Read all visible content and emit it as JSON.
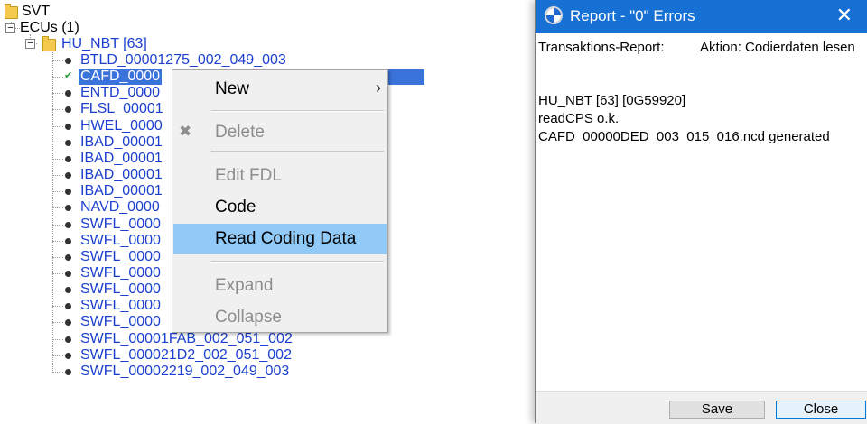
{
  "tree": {
    "svt_label": "SVT",
    "ecus_label": "ECUs (1)",
    "hu_label": "HU_NBT [63]",
    "items": [
      "BTLD_00001275_002_049_003",
      "CAFD_0000",
      "ENTD_0000",
      "FLSL_00001",
      "HWEL_0000",
      "IBAD_00001",
      "IBAD_00001",
      "IBAD_00001",
      "IBAD_00001",
      "NAVD_0000",
      "SWFL_0000",
      "SWFL_0000",
      "SWFL_0000",
      "SWFL_0000",
      "SWFL_0000",
      "SWFL_0000",
      "SWFL_0000",
      "SWFL_00001FAB_002_051_002",
      "SWFL_000021D2_002_051_002",
      "SWFL_00002219_002_049_003"
    ]
  },
  "context_menu": {
    "new": "New",
    "delete": "Delete",
    "edit_fdl": "Edit FDL",
    "code": "Code",
    "read_coding_data": "Read Coding Data",
    "expand": "Expand",
    "collapse": "Collapse"
  },
  "report": {
    "title": "Report - \"0\" Errors",
    "header_left": "Transaktions-Report:",
    "header_right": "Aktion: Codierdaten lesen",
    "lines": [
      "HU_NBT [63] [0G59920]",
      "readCPS o.k.",
      "CAFD_00000DED_003_015_016.ncd generated"
    ],
    "save_label": "Save",
    "close_label": "Close"
  },
  "colors": {
    "titlebar": "#1770d4",
    "selection": "#3a73d9",
    "menu_highlight": "#91c9f7",
    "tree_link": "#1b3fcf"
  }
}
